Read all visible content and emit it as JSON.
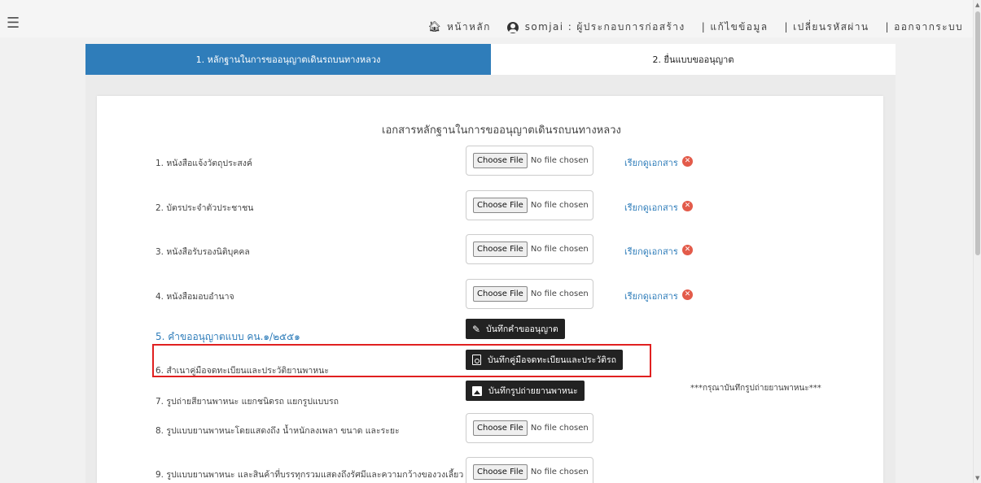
{
  "topnav": {
    "menu_icon": "hamburger-icon",
    "home_label": "หน้าหลัก",
    "user_label": "somjai : ผู้ประกอบการก่อสร้าง",
    "edit_label": "| แก้ไขข้อมูล",
    "password_label": "| เปลี่ยนรหัสผ่าน",
    "logout_label": "| ออกจากระบบ"
  },
  "tabs": [
    {
      "label": "1. หลักฐานในการขออนุญาตเดินรถบนทางหลวง",
      "active": true
    },
    {
      "label": "2. ยื่นแบบขออนุญาต",
      "active": false
    }
  ],
  "doc_title": "เอกสารหลักฐานในการขออนุญาตเดินรถบนทางหลวง",
  "file_input": {
    "choose_label": "Choose File",
    "no_file_label": "No file chosen"
  },
  "view_link_label": "เรียกดูเอกสาร",
  "rows": [
    {
      "label": "1. หนังสือแจ้งวัตถุประสงค์"
    },
    {
      "label": "2. บัตรประจำตัวประชาชน"
    },
    {
      "label": "3. หนังสือรับรองนิติบุคคล"
    },
    {
      "label": "4. หนังสือมอบอำนาจ"
    },
    {
      "label": "5. คำขออนุญาตแบบ คน.๑/๒๕๕๑"
    },
    {
      "label": "6. สำเนาคู่มือจดทะเบียนและประวัติยานพาหนะ"
    },
    {
      "label": "7. รูปถ่ายสียานพาหนะ แยกชนิดรถ แยกรูปแบบรถ"
    },
    {
      "label": "8. รูปแบบยานพาหนะโดยแสดงถึง น้ำหนักลงเพลา ขนาด และระยะ"
    },
    {
      "label": "9. รูปแบบยานพาหนะ และสินค้าที่บรรทุกรวมแสดงถึงรัศมีและความกว้างของวงเลี้ยว"
    }
  ],
  "buttons": {
    "save_request": "บันทึกคำขออนุญาต",
    "save_manual": "บันทึกคู่มือจดทะเบียนและประวัติรถ",
    "save_photo": "บันทึกรูปถ่ายยานพาหนะ"
  },
  "note": "***กรุณาบันทึกรูปถ่ายยานพาหนะ***",
  "colors": {
    "accent": "#2f7dba",
    "highlight": "#e02020",
    "delete": "#e35b4a",
    "button_dark": "#222222"
  }
}
